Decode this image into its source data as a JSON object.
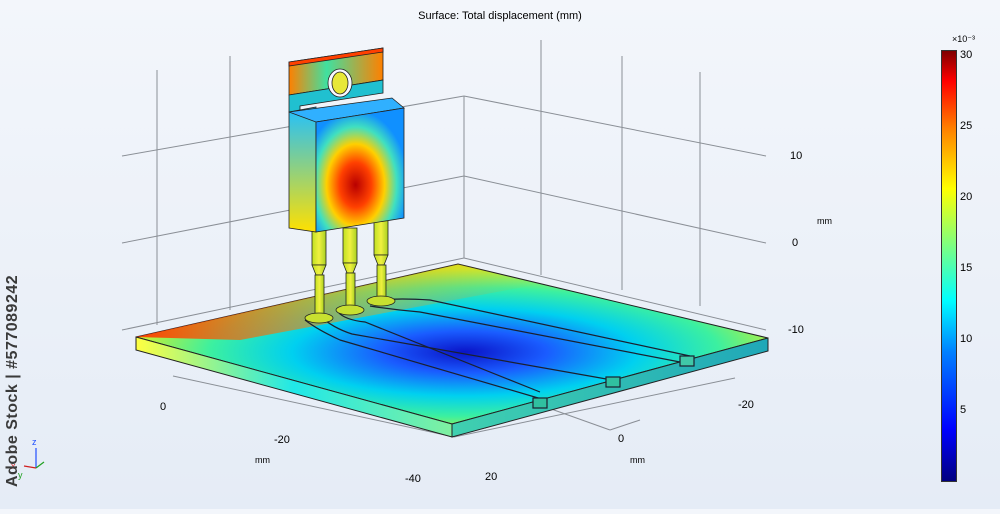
{
  "plot": {
    "title": "Surface: Total displacement (mm)"
  },
  "axes": {
    "z_ticks": [
      "10",
      "0",
      "-10"
    ],
    "z_unit": "mm",
    "left_axis_ticks": [
      "0",
      "-20",
      "-40"
    ],
    "left_axis_unit": "mm",
    "right_axis_ticks": [
      "-20",
      "0",
      "20"
    ],
    "right_axis_unit": "mm"
  },
  "colorbar": {
    "exponent": "×10⁻³",
    "ticks": [
      "30",
      "25",
      "20",
      "15",
      "10",
      "5"
    ]
  },
  "triad": {
    "z": "z",
    "x": "x",
    "y": "y"
  },
  "watermark": {
    "text": "Adobe Stock | #577089242"
  },
  "colors": {
    "pcb_edge": "#222222",
    "grid": "#8a8f96",
    "background_top": "#f3f6fb"
  }
}
